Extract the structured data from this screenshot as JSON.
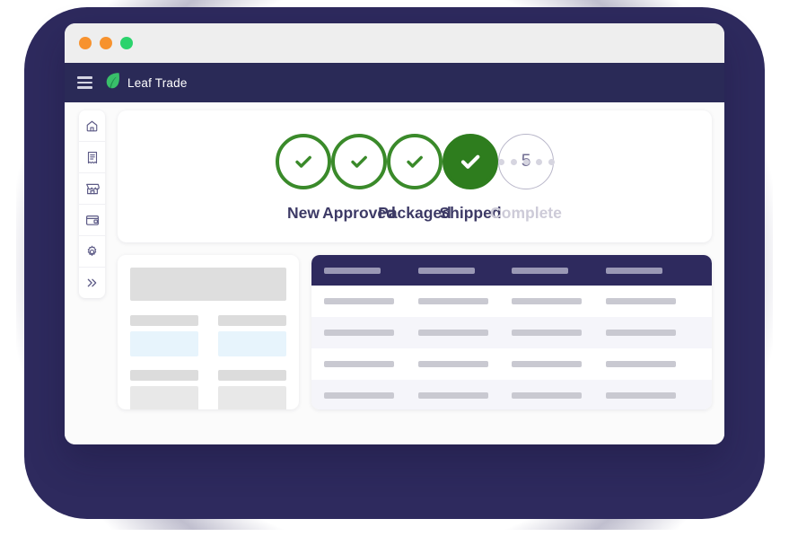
{
  "window": {
    "traffic_lights": [
      {
        "name": "close-button",
        "color": "#F7922E"
      },
      {
        "name": "minimize-button",
        "color": "#F7922E"
      },
      {
        "name": "maximize-button",
        "color": "#2BD36C"
      }
    ]
  },
  "navbar": {
    "menu_icon": "hamburger-icon",
    "logo_icon": "leaf-logo-icon",
    "brand": "Leaf Trade",
    "brand_color": "#ffffff",
    "background": "#2A2A57"
  },
  "sidebar": {
    "items": [
      {
        "icon": "home-icon",
        "label": "Home"
      },
      {
        "icon": "invoice-icon",
        "label": "Orders"
      },
      {
        "icon": "store-icon",
        "label": "Storefront"
      },
      {
        "icon": "wallet-icon",
        "label": "Payments"
      },
      {
        "icon": "gear-icon",
        "label": "Settings"
      },
      {
        "icon": "chevron-double-right-icon",
        "label": "Expand"
      }
    ]
  },
  "stepper": {
    "accent_done": "#3A8A2A",
    "accent_active": "#2E7D1E",
    "muted_color": "#cdcbd8",
    "steps": [
      {
        "label": "New",
        "state": "done",
        "number": "1",
        "glyph": "check"
      },
      {
        "label": "Approved",
        "state": "done",
        "number": "2",
        "glyph": "check"
      },
      {
        "label": "Packaged",
        "state": "done",
        "number": "3",
        "glyph": "check"
      },
      {
        "label": "Shipped",
        "state": "active",
        "number": "4",
        "glyph": "check"
      },
      {
        "label": "Complete",
        "state": "todo",
        "number": "5",
        "glyph": "number"
      }
    ],
    "connectors": [
      {
        "type": "line"
      },
      {
        "type": "line"
      },
      {
        "type": "line"
      },
      {
        "type": "dots",
        "count": 5
      }
    ]
  },
  "form_skeleton": {
    "hero": true,
    "field_rows": [
      {
        "type": "input",
        "columns": 2
      },
      {
        "type": "field",
        "columns": 2
      }
    ]
  },
  "table_skeleton": {
    "header_background": "#2E2A5E",
    "columns": 4,
    "rows": [
      {
        "alt": false
      },
      {
        "alt": true
      },
      {
        "alt": false
      },
      {
        "alt": true
      }
    ]
  },
  "backdrop": {
    "color": "#2E2A5E"
  }
}
